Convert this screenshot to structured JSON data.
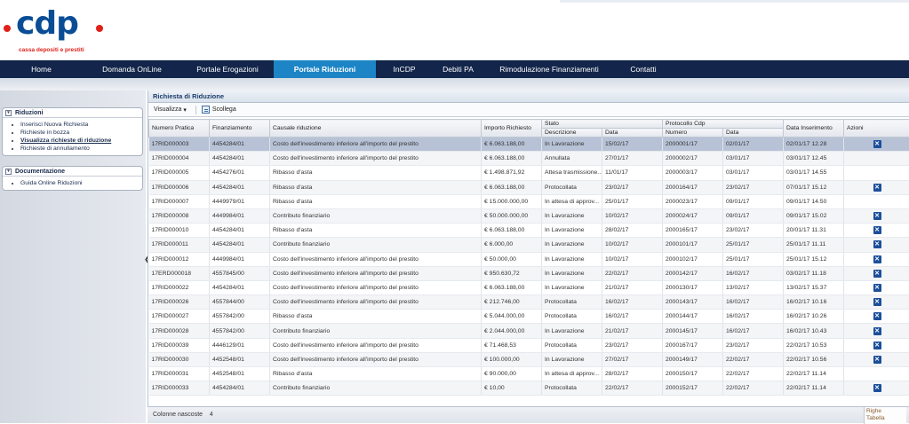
{
  "brand": {
    "name": "cdp",
    "tagline": "cassa depositi e prestiti"
  },
  "nav": [
    {
      "label": "Home",
      "active": false,
      "w": 93
    },
    {
      "label": "Domanda OnLine",
      "active": false,
      "w": 111
    },
    {
      "label": "Portale Erogazioni",
      "active": false,
      "w": 104
    },
    {
      "label": "Portale Riduzioni",
      "active": true,
      "w": 115
    },
    {
      "label": "InCDP",
      "active": false,
      "w": 64
    },
    {
      "label": "Debiti PA",
      "active": false,
      "w": 57
    },
    {
      "label": "Rimodulazione Finanziamenti",
      "active": false,
      "w": 148
    },
    {
      "label": "Contatti",
      "active": false,
      "w": 64
    }
  ],
  "sidebar": {
    "riduzioni": {
      "title": "Riduzioni",
      "items": [
        {
          "label": "Inserisci Nuova Richiesta",
          "selected": false
        },
        {
          "label": "Richieste in bozza",
          "selected": false
        },
        {
          "label": "Visualizza richieste di riduzione",
          "selected": true
        },
        {
          "label": "Richieste di annullamento",
          "selected": false
        }
      ]
    },
    "documentazione": {
      "title": "Documentazione",
      "items": [
        {
          "label": "Guida Online Riduzioni",
          "selected": false
        }
      ]
    }
  },
  "content": {
    "title": "Richiesta di Riduzione",
    "toolbar": {
      "visualizza": "Visualizza",
      "scollega": "Scollega"
    }
  },
  "table": {
    "group_headers": {
      "stato": "Stato",
      "protocollo": "Protocollo Cdp"
    },
    "headers": {
      "numero_pratica": "Numero Pratica",
      "finanziamento": "Finanziamento",
      "causale": "Causale riduzione",
      "importo": "Importo Richiesto",
      "stato_descrizione": "Descrizione",
      "stato_data": "Data",
      "protocollo_numero": "Numero",
      "protocollo_data": "Data",
      "data_inserimento": "Data Inserimento",
      "azioni": "Azioni"
    },
    "rows": [
      [
        "17RID000003",
        "4454284/01",
        "Costo dell'investimento inferiore all'importo del prestito",
        "€ 6.063.188,00",
        "In Lavorazione",
        "15/02/17",
        "2000001/17",
        "02/01/17",
        "02/01/17 12.28",
        true
      ],
      [
        "17RID000004",
        "4454284/01",
        "Costo dell'investimento inferiore all'importo del prestito",
        "€ 6.063.188,00",
        "Annullata",
        "27/01/17",
        "2000002/17",
        "03/01/17",
        "03/01/17 12.45",
        false
      ],
      [
        "17RID000005",
        "4454276/01",
        "Ribasso d'asta",
        "€ 1.498.871,92",
        "Attesa trasmissione...",
        "11/01/17",
        "2000003/17",
        "03/01/17",
        "03/01/17 14.55",
        false
      ],
      [
        "17RID000006",
        "4454284/01",
        "Ribasso d'asta",
        "€ 6.063.188,00",
        "Protocollata",
        "23/02/17",
        "2000164/17",
        "23/02/17",
        "07/01/17 15.12",
        true
      ],
      [
        "17RID000007",
        "4449979/01",
        "Ribasso d'asta",
        "€ 15.000.000,00",
        "In attesa di approv...",
        "25/01/17",
        "2000023/17",
        "09/01/17",
        "09/01/17 14.50",
        false
      ],
      [
        "17RID000008",
        "4449984/01",
        "Contributo finanziario",
        "€ 50.000.000,00",
        "In Lavorazione",
        "10/02/17",
        "2000024/17",
        "09/01/17",
        "09/01/17 15.02",
        true
      ],
      [
        "17RID000010",
        "4454284/01",
        "Ribasso d'asta",
        "€ 6.063.188,00",
        "In Lavorazione",
        "28/02/17",
        "2000165/17",
        "23/02/17",
        "20/01/17 11.31",
        true
      ],
      [
        "17RID000011",
        "4454284/01",
        "Contributo finanziario",
        "€ 6.000,00",
        "In Lavorazione",
        "10/02/17",
        "2000101/17",
        "25/01/17",
        "25/01/17 11.11",
        true
      ],
      [
        "17RID000012",
        "4449984/01",
        "Costo dell'investimento inferiore all'importo del prestito",
        "€ 50.000,00",
        "In Lavorazione",
        "10/02/17",
        "2000102/17",
        "25/01/17",
        "25/01/17 15.12",
        true
      ],
      [
        "17ERD000018",
        "4557845/00",
        "Costo dell'investimento inferiore all'importo del prestito",
        "€ 950.630,72",
        "In Lavorazione",
        "22/02/17",
        "2000142/17",
        "16/02/17",
        "03/02/17 11.18",
        true
      ],
      [
        "17RID000022",
        "4454284/01",
        "Costo dell'investimento inferiore all'importo del prestito",
        "€ 6.063.188,00",
        "In Lavorazione",
        "21/02/17",
        "2000130/17",
        "13/02/17",
        "13/02/17 15.37",
        true
      ],
      [
        "17RID000026",
        "4557844/00",
        "Costo dell'investimento inferiore all'importo del prestito",
        "€ 212.746,00",
        "Protocollata",
        "16/02/17",
        "2000143/17",
        "16/02/17",
        "16/02/17 10.16",
        true
      ],
      [
        "17RID000027",
        "4557842/00",
        "Ribasso d'asta",
        "€ 5.044.000,00",
        "Protocollata",
        "16/02/17",
        "2000144/17",
        "16/02/17",
        "16/02/17 10.26",
        true
      ],
      [
        "17RID000028",
        "4557842/00",
        "Contributo finanziario",
        "€ 2.044.000,00",
        "In Lavorazione",
        "21/02/17",
        "2000145/17",
        "16/02/17",
        "16/02/17 10.43",
        true
      ],
      [
        "17RID000039",
        "4446129/01",
        "Costo dell'investimento inferiore all'importo del prestito",
        "€ 71.468,53",
        "Protocollata",
        "23/02/17",
        "2000167/17",
        "23/02/17",
        "22/02/17 10.53",
        true
      ],
      [
        "17RID000030",
        "4452548/01",
        "Costo dell'investimento inferiore all'importo del prestito",
        "€ 100.000,00",
        "In Lavorazione",
        "27/02/17",
        "2000149/17",
        "22/02/17",
        "22/02/17 10.56",
        true
      ],
      [
        "17RID000031",
        "4452548/01",
        "Ribasso d'asta",
        "€ 90.000,00",
        "In attesa di approv...",
        "28/02/17",
        "2000150/17",
        "22/02/17",
        "22/02/17 11.14",
        false
      ],
      [
        "17RID000033",
        "4454284/01",
        "Contributo finanziario",
        "€ 10,00",
        "Protocollata",
        "22/02/17",
        "2000152/17",
        "22/02/17",
        "22/02/17 11.14",
        true
      ]
    ]
  },
  "footer": {
    "hidden_cols_label": "Colonne nascoste",
    "hidden_cols_count": "4",
    "righe": "Righe",
    "tabella": "Tabella"
  }
}
